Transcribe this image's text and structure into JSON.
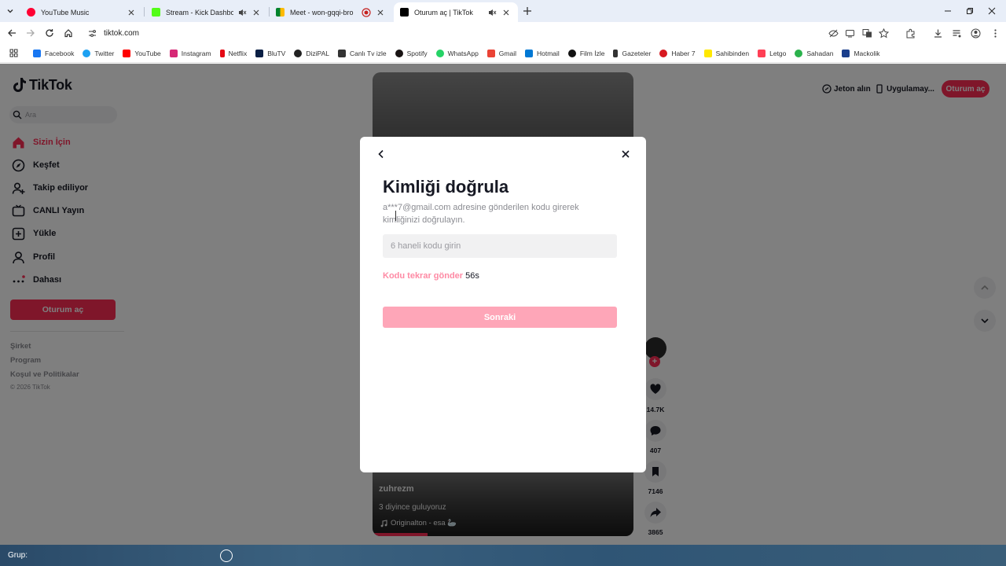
{
  "browser": {
    "tabs": [
      {
        "label": "YouTube Music",
        "favicon_color": "#ff0033",
        "active": false
      },
      {
        "label": "Stream - Kick Dashboard",
        "favicon_color": "#53fc18",
        "active": false
      },
      {
        "label": "Meet - won-gqqi-bro",
        "favicon_color": "#00832d",
        "active": false
      },
      {
        "label": "Oturum aç | TikTok",
        "favicon_color": "#000000",
        "active": true
      }
    ],
    "url": "tiktok.com"
  },
  "bookmarks": [
    {
      "label": "Facebook",
      "color": "#1877f2"
    },
    {
      "label": "Twitter",
      "color": "#1da1f2"
    },
    {
      "label": "YouTube",
      "color": "#ff0000"
    },
    {
      "label": "Instagram",
      "color": "#d62976"
    },
    {
      "label": "Netflix",
      "color": "#e50914"
    },
    {
      "label": "BluTV",
      "color": "#0a1f44"
    },
    {
      "label": "DiziPAL",
      "color": "#222222"
    },
    {
      "label": "Canlı Tv izle",
      "color": "#333333"
    },
    {
      "label": "Spotify",
      "color": "#191414"
    },
    {
      "label": "WhatsApp",
      "color": "#25d366"
    },
    {
      "label": "Gmail",
      "color": "#ea4335"
    },
    {
      "label": "Hotmail",
      "color": "#0078d4"
    },
    {
      "label": "Film İzle",
      "color": "#111111"
    },
    {
      "label": "Gazeteler",
      "color": "#333333"
    },
    {
      "label": "Haber 7",
      "color": "#d71920"
    },
    {
      "label": "Sahibinden",
      "color": "#ffe800"
    },
    {
      "label": "Letgo",
      "color": "#ff3f55"
    },
    {
      "label": "Sahadan",
      "color": "#2bb24c"
    },
    {
      "label": "Mackolik",
      "color": "#1a3e8c"
    }
  ],
  "tiktok": {
    "logo": "TikTok",
    "search_placeholder": "Ara",
    "nav": [
      {
        "label": "Sizin İçin",
        "icon": "home-icon",
        "active": true
      },
      {
        "label": "Keşfet",
        "icon": "compass-icon",
        "active": false
      },
      {
        "label": "Takip ediliyor",
        "icon": "following-icon",
        "active": false
      },
      {
        "label": "CANLI Yayın",
        "icon": "live-icon",
        "active": false
      },
      {
        "label": "Yükle",
        "icon": "upload-icon",
        "active": false
      },
      {
        "label": "Profil",
        "icon": "profile-icon",
        "active": false
      },
      {
        "label": "Dahası",
        "icon": "more-icon",
        "active": false
      }
    ],
    "login_button": "Oturum aç",
    "footer": [
      "Şirket",
      "Program",
      "Koşul ve Politikalar"
    ],
    "copyright": "© 2026 TikTok",
    "top_right": {
      "coins": "Jeton alın",
      "app": "Uygulamay...",
      "login": "Oturum aç"
    },
    "video": {
      "username": "zuhrezm",
      "description": "3 diyince guluyoruz",
      "music": "Originalton - esa 🦢",
      "likes": "14.7K",
      "comments": "407",
      "saves": "7146",
      "shares": "3865"
    },
    "accent": "#fe2c55"
  },
  "modal": {
    "title": "Kimliği doğrula",
    "description": "a***7@gmail.com adresine gönderilen kodu girerek kimliğinizi doğrulayın.",
    "code_placeholder": "6 haneli kodu girin",
    "resend_label": "Kodu tekrar gönder",
    "resend_timer": "56s",
    "next_label": "Sonraki"
  },
  "taskbar": {
    "group_label": "Grup:"
  }
}
